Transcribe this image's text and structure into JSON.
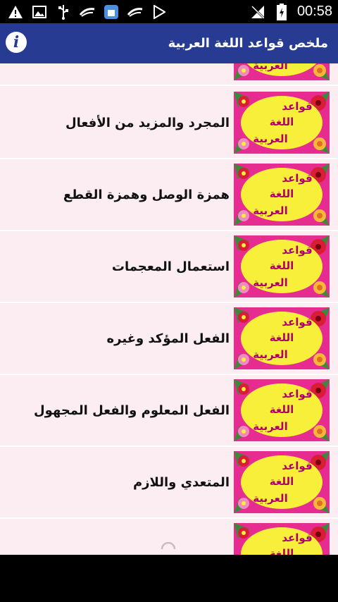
{
  "status_bar": {
    "time": "00:58",
    "left_icons": [
      "warning-icon",
      "image-icon",
      "usb-icon",
      "swift-keyboard-icon",
      "app-store-icon",
      "swift-keyboard-icon",
      "play-store-icon"
    ],
    "right_icons": [
      "no-signal-icon",
      "battery-charging-icon"
    ]
  },
  "app_bar": {
    "title": "ملخص قواعد اللغة العربية",
    "info_icon_glyph": "i",
    "color": "#263b91"
  },
  "list": {
    "items": [
      {
        "label": ""
      },
      {
        "label": "المجرد والمزيد من الأفعال"
      },
      {
        "label": "همزة الوصل وهمزة القطع"
      },
      {
        "label": "استعمال المعجمات"
      },
      {
        "label": "الفعل المؤكد وغيره"
      },
      {
        "label": "الفعل المعلوم والفعل المجهول"
      },
      {
        "label": "المتعدي واللازم"
      },
      {
        "label": ""
      }
    ],
    "thumbnail_text": [
      "قواعد",
      "اللغة",
      "العربية"
    ],
    "colors": {
      "background": "#fcedf3",
      "thumb_bg": "#e62b91",
      "thumb_oval": "#f7ef3a",
      "thumb_text": "#b0006a"
    }
  }
}
